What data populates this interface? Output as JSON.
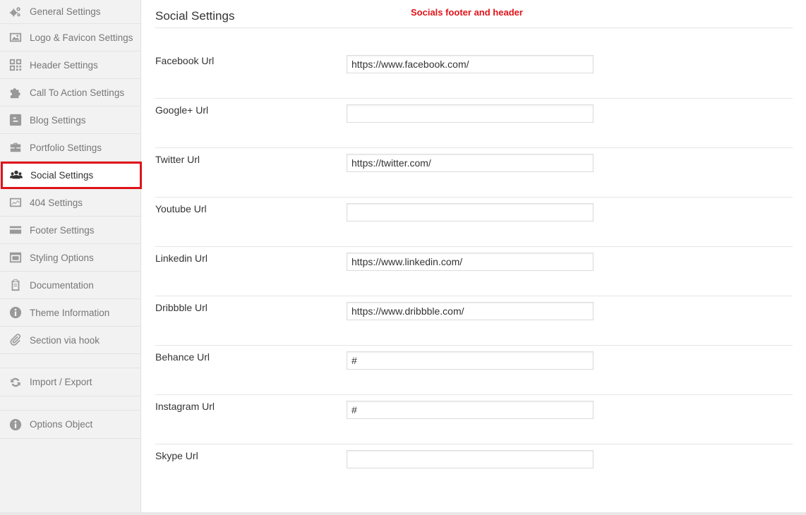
{
  "sidebar": {
    "items": [
      {
        "label": "General Settings",
        "icon": "gears-icon"
      },
      {
        "label": "Logo & Favicon Settings",
        "icon": "image-icon"
      },
      {
        "label": "Header Settings",
        "icon": "qrcode-icon"
      },
      {
        "label": "Call To Action Settings",
        "icon": "puzzle-icon"
      },
      {
        "label": "Blog Settings",
        "icon": "blogger-icon"
      },
      {
        "label": "Portfolio Settings",
        "icon": "briefcase-icon"
      },
      {
        "label": "Social Settings",
        "icon": "users-icon"
      },
      {
        "label": "404 Settings",
        "icon": "chart-icon"
      },
      {
        "label": "Footer Settings",
        "icon": "credit-card-icon"
      },
      {
        "label": "Styling Options",
        "icon": "window-icon"
      },
      {
        "label": "Documentation",
        "icon": "clipboard-icon"
      },
      {
        "label": "Theme Information",
        "icon": "info-icon"
      },
      {
        "label": "Section via hook",
        "icon": "paperclip-icon"
      }
    ],
    "import_export": {
      "label": "Import / Export",
      "icon": "refresh-icon"
    },
    "options_object": {
      "label": "Options Object",
      "icon": "info-icon"
    },
    "active_index": 6,
    "highlight_color": "#e0131a"
  },
  "main": {
    "title": "Social Settings",
    "annotation": "Socials footer and header",
    "fields": [
      {
        "label": "Facebook Url",
        "value": "https://www.facebook.com/"
      },
      {
        "label": "Google+ Url",
        "value": ""
      },
      {
        "label": "Twitter Url",
        "value": "https://twitter.com/"
      },
      {
        "label": "Youtube Url",
        "value": ""
      },
      {
        "label": "Linkedin Url",
        "value": "https://www.linkedin.com/"
      },
      {
        "label": "Dribbble Url",
        "value": "https://www.dribbble.com/"
      },
      {
        "label": "Behance Url",
        "value": "#"
      },
      {
        "label": "Instagram Url",
        "value": "#"
      },
      {
        "label": "Skype Url",
        "value": ""
      }
    ]
  }
}
